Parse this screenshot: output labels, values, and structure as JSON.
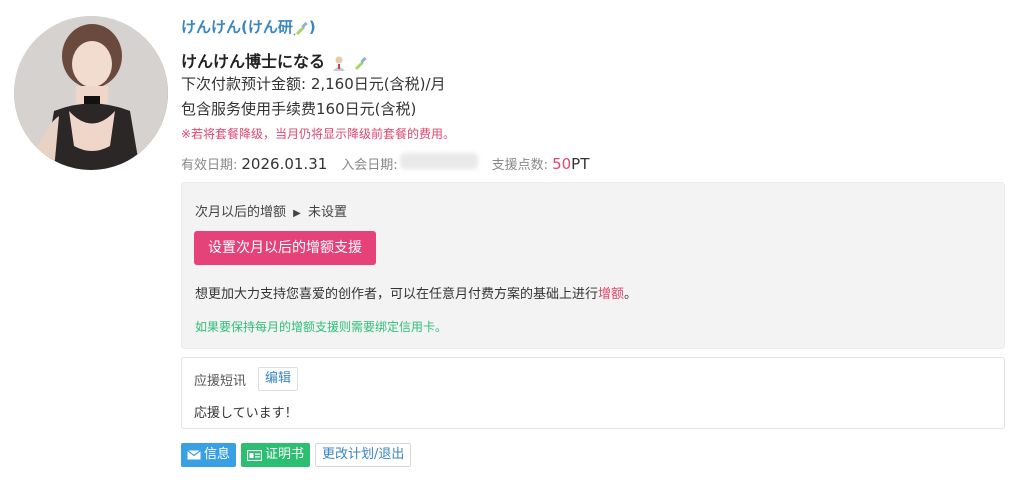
{
  "creator": {
    "name": "けんけん(けん研",
    "name_close": ")",
    "icon": "syringe-icon"
  },
  "plan": {
    "title": "けんけん博士になる",
    "icons": [
      "doctor-icon",
      "syringe-icon"
    ],
    "next_payment": "下次付款预计金额: 2,160日元(含税)/月",
    "service_fee": "包含服务使用手续费160日元(含税)",
    "downgrade_note": "※若将套餐降级，当月仍将显示降级前套餐的费用。"
  },
  "meta": {
    "valid_label": "有效日期:",
    "valid_value": "2026.01.31",
    "join_label": "入会日期:",
    "points_label": "支援点数:",
    "points_value": "50",
    "points_unit": "PT"
  },
  "boost": {
    "label": "次月以后的增额",
    "arrow": "▶",
    "status": "未设置",
    "button": "设置次月以后的增额支援",
    "text_before": "想更加大力支持您喜爱的创作者，可以在任意月付费方案的基础上进行",
    "text_link": "增额",
    "text_after": "。",
    "credit_note": "如果要保持每月的增额支援则需要绑定信用卡。"
  },
  "message": {
    "label": "应援短讯",
    "edit": "编辑",
    "text": "応援しています！"
  },
  "actions": {
    "message": "信息",
    "certificate": "证明书",
    "change": "更改计划/退出"
  },
  "colors": {
    "link_blue": "#3a86c2",
    "accent_pink": "#e5427a",
    "green": "#2cbf72",
    "msg_blue": "#3aa0e4"
  }
}
